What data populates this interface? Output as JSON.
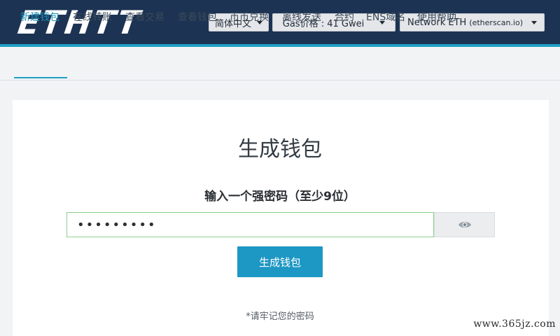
{
  "header": {
    "logo_text": "ETHTT",
    "language": {
      "selected": "简体中文"
    },
    "gas": {
      "label": "Gas价格 : 41 Gwei"
    },
    "network": {
      "label": "Network ETH",
      "sub": "(etherscan.io)"
    }
  },
  "nav": {
    "items": [
      {
        "label": "新建钱包",
        "active": true
      },
      {
        "label": "在线转账"
      },
      {
        "label": "查看交易"
      },
      {
        "label": "查看钱包"
      },
      {
        "label": "币币兑换"
      },
      {
        "label": "离线发送"
      },
      {
        "label": "合约"
      },
      {
        "label": "ENS域名"
      },
      {
        "label": "使用帮助"
      }
    ]
  },
  "main": {
    "title": "生成钱包",
    "password_label": "输入一个强密码（至少9位）",
    "password_value": "•••••••••",
    "generate_label": "生成钱包",
    "note": "*请牢记您的密码"
  },
  "watermark": "www.365jz.com",
  "colors": {
    "header_bg": "#1c3353",
    "accent": "#1fa0c4",
    "button": "#1d97c3"
  }
}
